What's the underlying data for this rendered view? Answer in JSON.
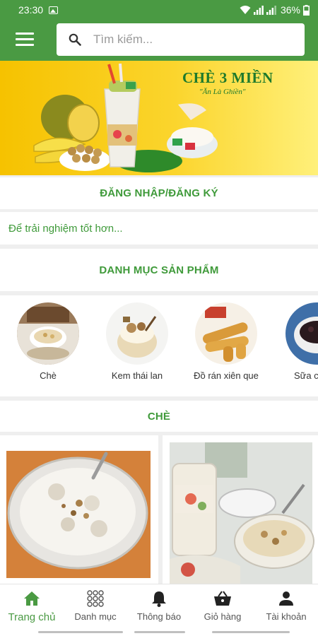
{
  "status_bar": {
    "time": "23:30",
    "battery": "36%"
  },
  "header": {
    "search_placeholder": "Tìm kiếm..."
  },
  "banner": {
    "title": "CHÈ 3 MIỀN",
    "subtitle": "\"Ăn Là Ghiền\""
  },
  "login": {
    "title": "ĐĂNG NHẬP/ĐĂNG KÝ",
    "hint": "Để trải nghiệm tốt hơn..."
  },
  "categories": {
    "title": "DANH MỤC SẢN PHẨM",
    "items": [
      {
        "label": "Chè"
      },
      {
        "label": "Kem thái lan"
      },
      {
        "label": "Đồ rán xiên que"
      },
      {
        "label": "Sữa c"
      }
    ]
  },
  "products": {
    "title": "CHÈ"
  },
  "bottom_nav": {
    "items": [
      {
        "label": "Trang chủ",
        "icon": "home-icon"
      },
      {
        "label": "Danh mục",
        "icon": "grid-icon"
      },
      {
        "label": "Thông báo",
        "icon": "bell-icon"
      },
      {
        "label": "Giỏ hàng",
        "icon": "basket-icon"
      },
      {
        "label": "Tài khoản",
        "icon": "person-icon"
      }
    ]
  },
  "colors": {
    "primary": "#4a9a43",
    "accent_text": "#3f9a3a",
    "background": "#efefef"
  }
}
